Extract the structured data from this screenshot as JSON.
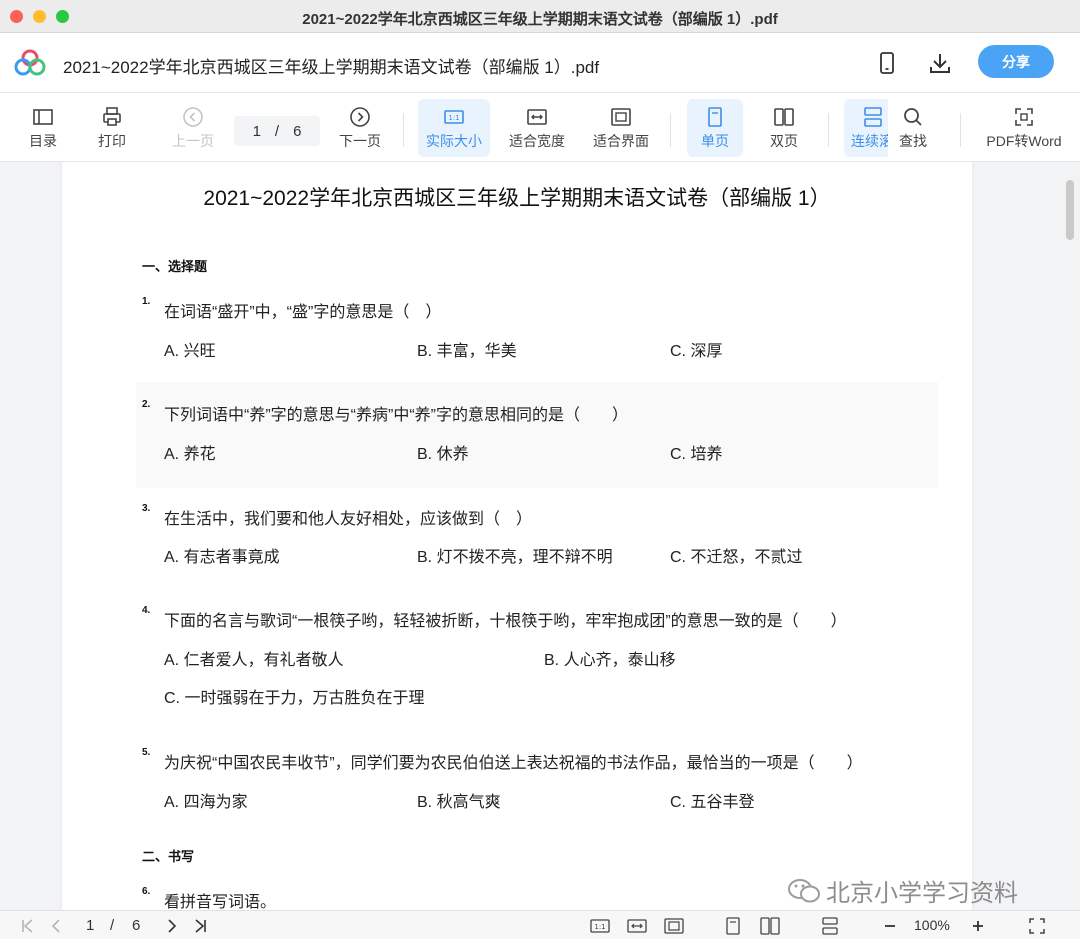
{
  "window": {
    "title": "2021~2022学年北京西城区三年级上学期期末语文试卷（部编版 1）.pdf"
  },
  "header": {
    "doc_title": "2021~2022学年北京西城区三年级上学期期末语文试卷（部编版 1）.pdf",
    "share_label": "分享",
    "icons": [
      "phone-icon",
      "download-icon"
    ]
  },
  "toolbar": {
    "toc": "目录",
    "print": "打印",
    "prev_page": "上一页",
    "current_page": "1",
    "page_sep": "/",
    "total_pages": "6",
    "next_page": "下一页",
    "actual_size": "实际大小",
    "fit_width": "适合宽度",
    "fit_page": "适合界面",
    "single_page": "单页",
    "double_page": "双页",
    "continuous": "连续滚",
    "find": "查找",
    "pdf_to_word": "PDF转Word"
  },
  "document": {
    "title": "2021~2022学年北京西城区三年级上学期期末语文试卷（部编版 1）",
    "section1": "一、选择题",
    "section2": "二、书写",
    "questions": [
      {
        "num": "1.",
        "text": "在词语“盛开”中，“盛”字的意思是（　）",
        "options": [
          "A. 兴旺",
          "B. 丰富，华美",
          "C. 深厚"
        ]
      },
      {
        "num": "2.",
        "text": "下列词语中“养”字的意思与“养病”中“养”字的意思相同的是（　　）",
        "options": [
          "A. 养花",
          "B. 休养",
          "C. 培养"
        ]
      },
      {
        "num": "3.",
        "text": "在生活中，我们要和他人友好相处，应该做到（　）",
        "options": [
          "A. 有志者事竟成",
          "B. 灯不拨不亮，理不辩不明",
          "C. 不迁怒，不贰过"
        ]
      },
      {
        "num": "4.",
        "text": "下面的名言与歌词“一根筷子哟，轻轻被折断，十根筷于哟，牢牢抱成团”的意思一致的是（　　）",
        "options": [
          "A. 仁者爱人，有礼者敬人",
          "B. 人心齐，泰山移",
          "C. 一时强弱在于力，万古胜负在于理"
        ]
      },
      {
        "num": "5.",
        "text": "为庆祝“中国农民丰收节”，同学们要为农民伯伯送上表达祝福的书法作品，最恰当的一项是（　　）",
        "options": [
          "A. 四海为家",
          "B. 秋高气爽",
          "C. 五谷丰登"
        ]
      },
      {
        "num": "6.",
        "text": "看拼音写词语。"
      }
    ]
  },
  "statusbar": {
    "current_page": "1",
    "page_sep": "/",
    "total_pages": "6",
    "zoom": "100%"
  },
  "watermark": {
    "text": "北京小学学习资料"
  },
  "colors": {
    "accent": "#4aa3f5",
    "active_bg": "#e8f3fd",
    "active_text": "#3d8ee8"
  }
}
